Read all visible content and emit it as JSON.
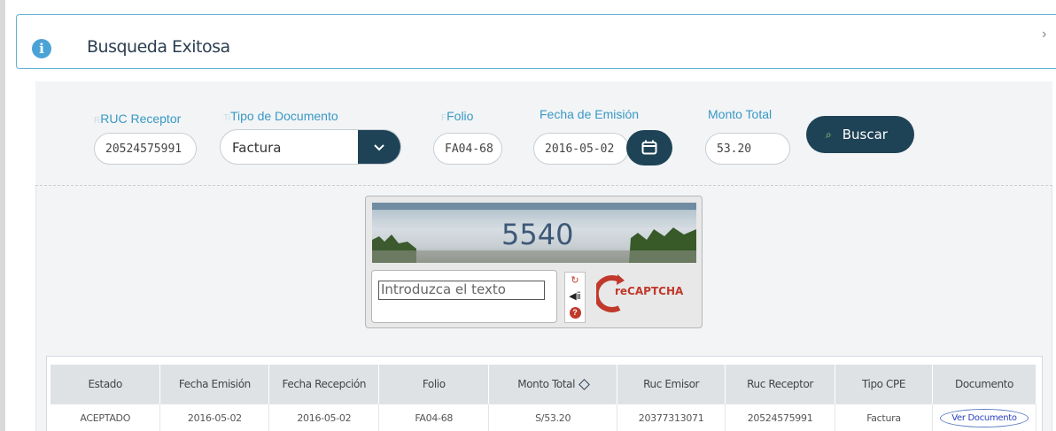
{
  "alert": {
    "icon": "info-icon",
    "title": "Busqueda Exitosa",
    "close_icon": "close-icon"
  },
  "form": {
    "ruc_receptor": {
      "label": "RUC Receptor",
      "value": "20524575991"
    },
    "tipo_documento": {
      "label": "Tipo de Documento",
      "value": "Factura",
      "icon": "chevron-down-icon"
    },
    "folio": {
      "label": "Folio",
      "value": "FA04-68"
    },
    "fecha_emision": {
      "label": "Fecha de Emisión",
      "value": "2016-05-02",
      "icon": "calendar-icon"
    },
    "monto_total": {
      "label": "Monto Total",
      "value": "53.20"
    },
    "search_button": {
      "label": "Buscar",
      "icon": "search-icon"
    }
  },
  "captcha": {
    "image_text": "5540",
    "input_placeholder": "Introduzca el texto",
    "brand": "reCAPTCHA",
    "tools": [
      "refresh-icon",
      "audio-icon",
      "help-icon"
    ]
  },
  "table": {
    "headers": [
      "Estado",
      "Fecha Emisión",
      "Fecha Recepción",
      "Folio",
      "Monto Total",
      "Ruc Emisor",
      "Ruc Receptor",
      "Tipo CPE",
      "Documento"
    ],
    "rows": [
      [
        "ACEPTADO",
        "2016-05-02",
        "2016-05-02",
        "FA04-68",
        "S/53.20",
        "20377313071",
        "20524575991",
        "Factura",
        "Ver Documento"
      ]
    ]
  },
  "colors": {
    "primary": "#1f4356",
    "accent": "#3a98c4",
    "info": "#4aa3d6",
    "link": "#2a3fbf"
  }
}
